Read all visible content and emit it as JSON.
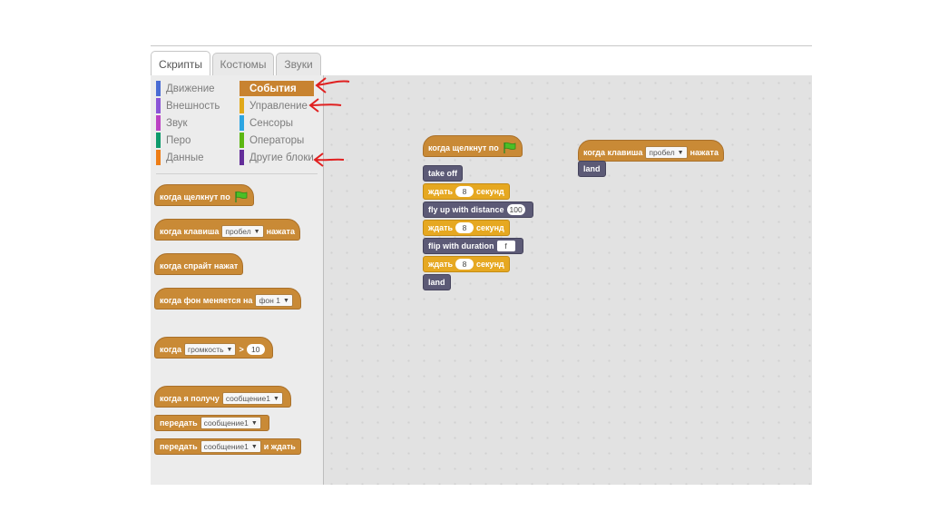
{
  "tabs": [
    {
      "label": "Скрипты",
      "active": true
    },
    {
      "label": "Костюмы",
      "active": false
    },
    {
      "label": "Звуки",
      "active": false
    }
  ],
  "categories": {
    "left": [
      {
        "label": "Движение",
        "color": "#4a6cd4"
      },
      {
        "label": "Внешность",
        "color": "#8a55d7"
      },
      {
        "label": "Звук",
        "color": "#bb42c3"
      },
      {
        "label": "Перо",
        "color": "#0e9a6c"
      },
      {
        "label": "Данные",
        "color": "#ee7d16"
      }
    ],
    "right": [
      {
        "label": "События",
        "color": "#c88330",
        "selected": true
      },
      {
        "label": "Управление",
        "color": "#e1a91a"
      },
      {
        "label": "Сенсоры",
        "color": "#2ca5e2"
      },
      {
        "label": "Операторы",
        "color": "#5cb712"
      },
      {
        "label": "Другие блоки",
        "color": "#632d99"
      }
    ]
  },
  "palette_blocks": {
    "when_flag": "когда щелкнут по",
    "when_key": {
      "text": "когда клавиша",
      "key": "пробел",
      "suffix": "нажата"
    },
    "when_sprite": "когда спрайт нажат",
    "when_backdrop": {
      "text": "когда фон меняется на",
      "value": "фон 1"
    },
    "when_loudness": {
      "text": "когда",
      "sensor": "громкость",
      "op": ">",
      "value": "10"
    },
    "when_receive": {
      "text": "когда я получу",
      "value": "сообщение1"
    },
    "broadcast": {
      "text": "передать",
      "value": "сообщение1"
    },
    "broadcast_wait": {
      "text": "передать",
      "value": "сообщение1",
      "suffix": "и ждать"
    }
  },
  "script1": {
    "hat": "когда щелкнут по",
    "takeoff": "take off",
    "wait1": {
      "text": "ждать",
      "value": "8",
      "suffix": "секунд"
    },
    "flyup": {
      "text": "fly up with distance",
      "value": "100"
    },
    "wait2": {
      "text": "ждать",
      "value": "8",
      "suffix": "секунд"
    },
    "flip": {
      "text": "flip with duration",
      "value": "f"
    },
    "wait3": {
      "text": "ждать",
      "value": "8",
      "suffix": "секунд"
    },
    "land": "land"
  },
  "script2": {
    "hat": {
      "text": "когда клавиша",
      "key": "пробел",
      "suffix": "нажата"
    },
    "land": "land"
  },
  "colors": {
    "events": "#c98a36",
    "control": "#e6a821",
    "more_blocks": "#5c5a76",
    "annotation": "#e02020"
  }
}
